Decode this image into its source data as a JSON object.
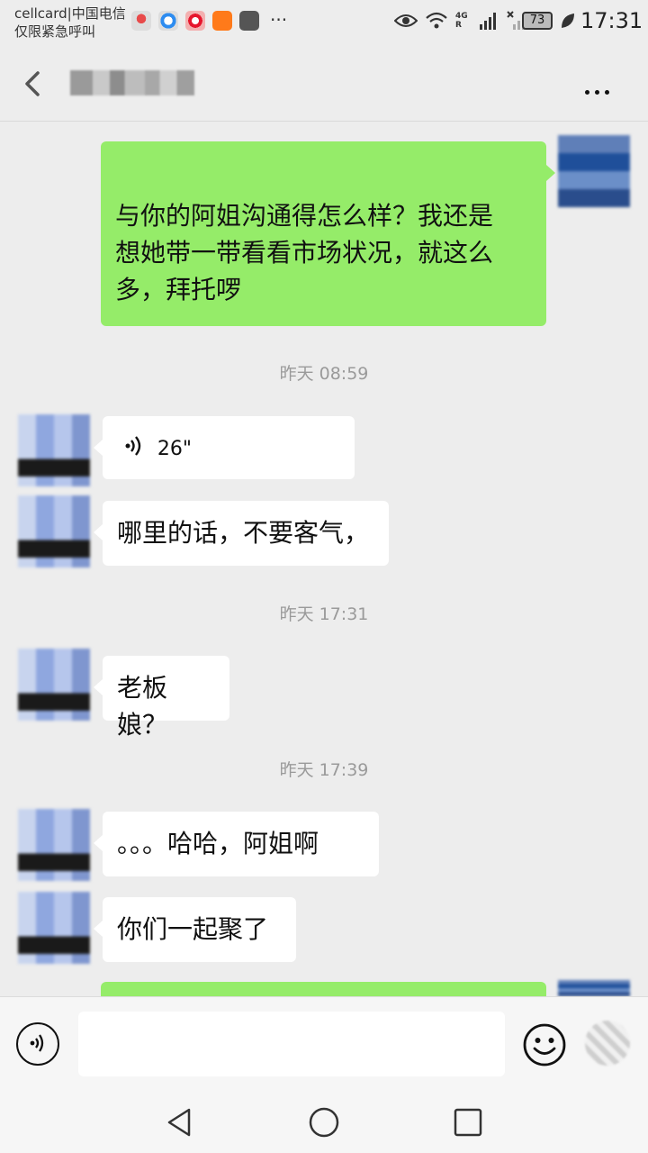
{
  "status_bar": {
    "carrier_line1": "cellcard|中国电信",
    "carrier_line2": "仅限紧急呼叫",
    "notif_more": "···",
    "network_type": "4G R",
    "battery": "73",
    "time": "17:31"
  },
  "header": {
    "back_icon": "back-chevron-icon",
    "more_icon": "more-dots-icon"
  },
  "messages": [
    {
      "type": "text",
      "direction": "out",
      "text_lines": [
        "与你的阿姐沟通得怎么样？我还是",
        "想她带一带看看市场状况，就这么",
        "多，拜托啰"
      ]
    },
    {
      "type": "timestamp",
      "text": "昨天 08:59"
    },
    {
      "type": "voice",
      "direction": "in",
      "duration": "26\""
    },
    {
      "type": "text",
      "direction": "in",
      "text": "哪里的话，不要客气，"
    },
    {
      "type": "timestamp",
      "text": "昨天 17:31"
    },
    {
      "type": "text",
      "direction": "in",
      "text": "老板娘？"
    },
    {
      "type": "timestamp",
      "text": "昨天 17:39"
    },
    {
      "type": "text",
      "direction": "in",
      "text": "。。。哈哈，阿姐啊"
    },
    {
      "type": "text",
      "direction": "in",
      "text": "你们一起聚了"
    }
  ],
  "input_bar": {
    "voice_icon": "voice-input-icon",
    "emoji_icon": "emoji-icon",
    "plus_icon": "plus-icon",
    "input_value": ""
  },
  "nav_bar": {
    "back": "nav-back-icon",
    "home": "nav-home-icon",
    "recents": "nav-recents-icon"
  },
  "colors": {
    "background": "#ededed",
    "outgoing_bubble": "#95ec69",
    "incoming_bubble": "#ffffff",
    "timestamp_text": "#9a9a9a"
  }
}
